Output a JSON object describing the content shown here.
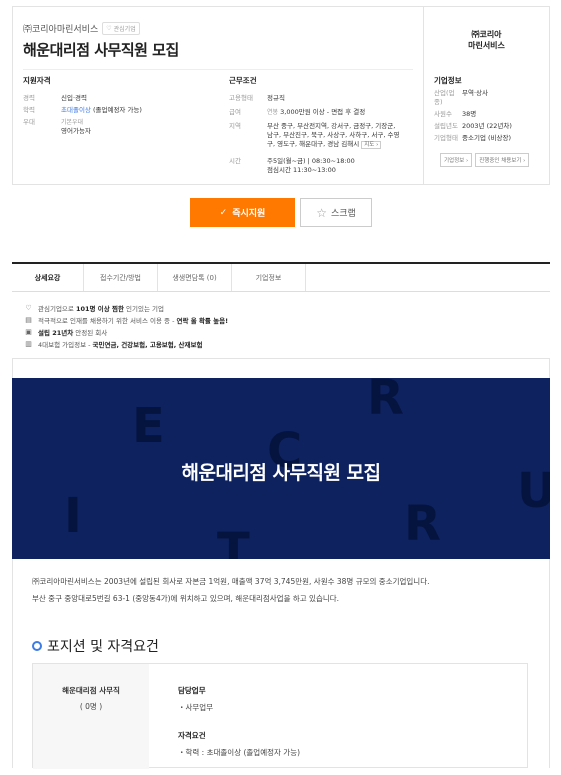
{
  "header": {
    "company": "㈜코리아마린서비스",
    "fav_label": "관심기업",
    "title": "해운대리점 사무직원 모집"
  },
  "qualification": {
    "heading": "지원자격",
    "rows": [
      {
        "k": "경력",
        "v": "신입·경력"
      },
      {
        "k": "학력",
        "v1": "초대졸이상",
        "v2": " (졸업예정자 가능)"
      },
      {
        "k": "우대",
        "v1": "기본우대",
        "v2": "영어가능자"
      }
    ]
  },
  "conditions": {
    "heading": "근무조건",
    "type_k": "고용형태",
    "type_v": "정규직",
    "pay_k": "급여",
    "pay_pre": "연봉",
    "pay_v": "3,000만원 이상 - 면접 후 결정",
    "area_k": "지역",
    "area_v": "부산 중구, 부산전지역, 강서구, 금정구, 기장군, 남구, 부산진구, 북구, 사상구, 사하구, 서구, 수영구, 영도구, 해운대구, 경남 김해시",
    "map_label": "지도",
    "time_k": "시간",
    "time_v1": "주5일(월~금) | 08:30~18:00",
    "time_v2": "점심시간 11:30~13:00"
  },
  "side": {
    "logo_line1": "㈜코리아",
    "logo_line2": "마린서비스",
    "heading": "기업정보",
    "rows": [
      {
        "k": "산업(업종)",
        "v": "무역·상사"
      },
      {
        "k": "사원수",
        "v": "38명"
      },
      {
        "k": "설립년도",
        "v": "2003년 (22년차)"
      },
      {
        "k": "기업형태",
        "v": "중소기업 (비상장)"
      }
    ],
    "btn_info": "기업정보 ›",
    "btn_jobs": "진행중인 채용보기 ›"
  },
  "actions": {
    "apply": "즉시지원",
    "scrap": "스크랩"
  },
  "tabs": [
    "상세요강",
    "접수기간/방법",
    "생생면담톡 (0)",
    "기업정보"
  ],
  "info": [
    {
      "pre": "관심기업으로 ",
      "bold": "101명 이상 찜한",
      "post": " 인기있는 기업"
    },
    {
      "pre": "적극적으로 인재를 채용하기 위한 서비스 이용 중 - ",
      "bold": "연락 올 확률 높음!",
      "post": ""
    },
    {
      "pre": "",
      "bold": "설립 21년차",
      "post": " 안정된 회사"
    },
    {
      "pre": "4대보험 가입정보 - ",
      "bold": "국민연금, 건강보험, 고용보험, 산재보험",
      "post": ""
    }
  ],
  "banner": {
    "title": "해운대리점 사무직원 모집",
    "letters": [
      "E",
      "R",
      "C",
      "R",
      "U",
      "I",
      "T"
    ]
  },
  "intro": {
    "line1": "㈜코리아마린서비스는 2003년에 설립된 회사로 자본금 1억원, 매출액 37억 3,745만원, 사원수 38명 규모의 중소기업입니다.",
    "line2": "부산 중구 중앙대로5번길 63-1 (중앙동4가)에 위치하고 있으며, 해운대리점사업을 하고 있습니다."
  },
  "section": {
    "title": "포지션 및 자격요건"
  },
  "position": {
    "name": "해운대리점 사무직",
    "count": "( 0명 )",
    "duty_h": "담당업무",
    "duty_v": "・사무업무",
    "qual_h": "자격요건",
    "qual_v": "・학력 : 초대졸이상 (졸업예정자 가능)"
  },
  "colors": {
    "accent": "#ff7800",
    "link": "#3d7be5",
    "banner": "#0e2260"
  }
}
